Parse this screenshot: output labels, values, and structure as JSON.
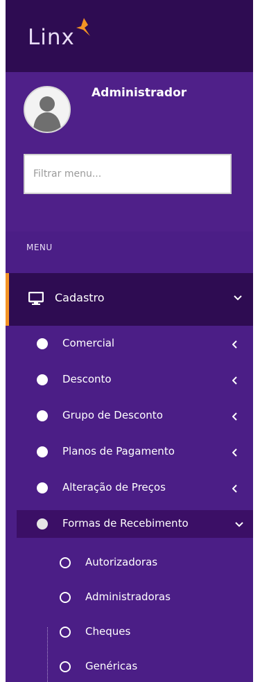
{
  "brand": {
    "logo_text": "Linx",
    "accent": "#f39324"
  },
  "profile": {
    "name": "Administrador"
  },
  "filter": {
    "placeholder": "Filtrar menu..."
  },
  "menu": {
    "header": "MENU",
    "section": {
      "label": "Cadastro",
      "icon": "monitor-icon",
      "expanded": true
    },
    "items": [
      {
        "label": "Comercial",
        "expanded": false
      },
      {
        "label": "Desconto",
        "expanded": false
      },
      {
        "label": "Grupo de Desconto",
        "expanded": false
      },
      {
        "label": "Planos de Pagamento",
        "expanded": false
      },
      {
        "label": "Alteração de Preços",
        "expanded": false
      },
      {
        "label": "Formas de Recebimento",
        "expanded": true
      }
    ],
    "subitems": [
      {
        "label": "Autorizadoras"
      },
      {
        "label": "Administradoras"
      },
      {
        "label": "Cheques"
      },
      {
        "label": "Genéricas"
      }
    ]
  },
  "colors": {
    "sidebar_bg": "#4b1e86",
    "topbar_bg": "#2e0c52",
    "active_bg": "#2e0c52",
    "text": "#ffffff"
  }
}
